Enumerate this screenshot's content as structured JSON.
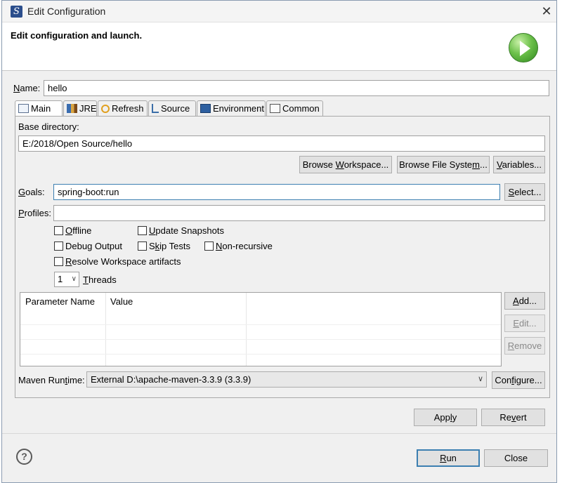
{
  "window": {
    "title": "Edit Configuration",
    "close_glyph": "✕"
  },
  "banner": {
    "title": "Edit configuration and launch.",
    "icon": "run-launch-icon"
  },
  "name": {
    "label_pre": "",
    "label_u": "N",
    "label_post": "ame:",
    "value": "hello"
  },
  "tabs": [
    {
      "label": "Main",
      "icon": "main-tab-icon",
      "active": true
    },
    {
      "label": "JRE",
      "icon": "jre-icon"
    },
    {
      "label": "Refresh",
      "icon": "refresh-icon"
    },
    {
      "label": "Source",
      "icon": "source-icon"
    },
    {
      "label": "Environment",
      "icon": "environment-icon"
    },
    {
      "label": "Common",
      "icon": "common-icon"
    }
  ],
  "main": {
    "base_dir_label": "Base directory:",
    "base_dir_value": "E:/2018/Open Source/hello",
    "browse_workspace": {
      "pre": "Browse ",
      "u": "W",
      "post": "orkspace..."
    },
    "browse_filesystem": {
      "pre": "Browse File Syste",
      "u": "m",
      "post": "..."
    },
    "variables": {
      "pre": "",
      "u": "V",
      "post": "ariables..."
    },
    "goals_label": {
      "pre": "",
      "u": "G",
      "post": "oals:"
    },
    "goals_value": "spring-boot:run",
    "select_button": {
      "pre": "",
      "u": "S",
      "post": "elect..."
    },
    "profiles_label": {
      "pre": "",
      "u": "P",
      "post": "rofiles:"
    },
    "profiles_value": "",
    "checkboxes": {
      "offline": {
        "pre": "",
        "u": "O",
        "post": "ffline",
        "checked": false
      },
      "update_snapshots": {
        "pre": "",
        "u": "U",
        "post": "pdate Snapshots",
        "checked": false
      },
      "debug_output": {
        "pre": "Debu",
        "u": "g",
        "post": " Output",
        "checked": false
      },
      "skip_tests": {
        "pre": "S",
        "u": "k",
        "post": "ip Tests",
        "checked": false
      },
      "non_recursive": {
        "pre": "",
        "u": "N",
        "post": "on-recursive",
        "checked": false
      },
      "resolve_workspace": {
        "pre": "",
        "u": "R",
        "post": "esolve Workspace artifacts",
        "checked": false
      }
    },
    "threads_value": "1",
    "threads_label": {
      "pre": "",
      "u": "T",
      "post": "hreads"
    },
    "param_table": {
      "columns": [
        "Parameter Name",
        "Value"
      ],
      "rows": []
    },
    "add_button": {
      "pre": "",
      "u": "A",
      "post": "dd..."
    },
    "edit_button": {
      "pre": "",
      "u": "E",
      "post": "dit..."
    },
    "remove_button": {
      "pre": "",
      "u": "R",
      "post": "emove"
    },
    "runtime_label": {
      "pre": "Maven Run",
      "u": "t",
      "post": "ime:"
    },
    "runtime_value": "External D:\\apache-maven-3.3.9 (3.3.9)",
    "configure_button": {
      "pre": "Con",
      "u": "f",
      "post": "igure..."
    }
  },
  "footer": {
    "apply": {
      "pre": "App",
      "u": "l",
      "post": "y"
    },
    "revert": {
      "pre": "Re",
      "u": "v",
      "post": "ert"
    },
    "run": {
      "pre": "",
      "u": "R",
      "post": "un"
    },
    "close": "Close",
    "help_glyph": "?"
  }
}
